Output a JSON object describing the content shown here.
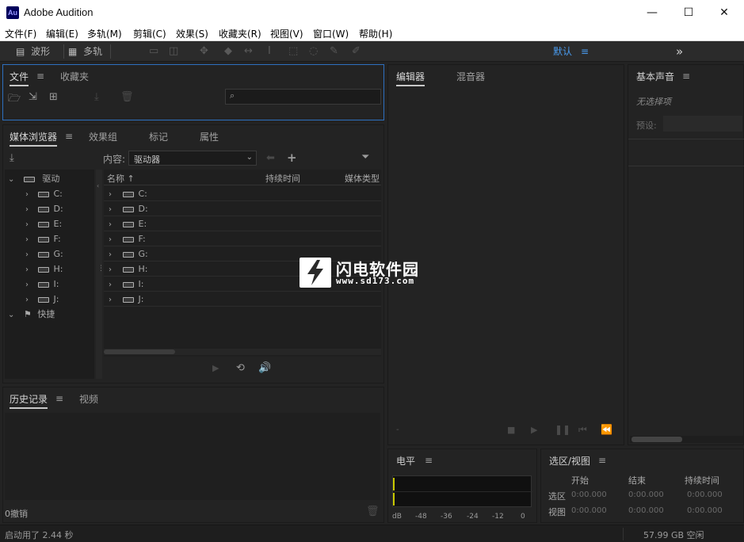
{
  "window": {
    "app_icon": "Au",
    "title": "Adobe Audition",
    "minimize": "—",
    "maximize": "☐",
    "close": "✕"
  },
  "menubar": [
    "文件(F)",
    "编辑(E)",
    "多轨(M)",
    "剪辑(C)",
    "效果(S)",
    "收藏夹(R)",
    "视图(V)",
    "窗口(W)",
    "帮助(H)"
  ],
  "toolbar": {
    "waveform_label": "波形",
    "multitrack_label": "多轨",
    "workspace_label": "默认",
    "overflow_glyph": "»"
  },
  "files_panel": {
    "tabs": [
      "文件",
      "收藏夹"
    ],
    "search_placeholder": ""
  },
  "media_browser": {
    "tabs": [
      "媒体浏览器",
      "效果组",
      "标记",
      "属性"
    ],
    "content_label": "内容:",
    "content_value": "驱动器",
    "tree_root": "驱动",
    "tree_drives": [
      "C:",
      "D:",
      "E:",
      "F:",
      "G:",
      "H:",
      "I:",
      "J:"
    ],
    "tree_shortcuts": "快捷",
    "columns": [
      "名称",
      "持续时间",
      "媒体类型"
    ],
    "list_drives": [
      "C:",
      "D:",
      "E:",
      "F:",
      "G:",
      "H:",
      "I:",
      "J:"
    ]
  },
  "history_panel": {
    "tabs": [
      "历史记录",
      "视频"
    ],
    "undo_count": "0撤销"
  },
  "editor_panel": {
    "tabs": [
      "编辑器",
      "混音器"
    ]
  },
  "essential_sound": {
    "title": "基本声音",
    "no_selection": "无选择项",
    "preset_label": "预设:"
  },
  "level_meter": {
    "title": "电平",
    "scale": [
      "dB",
      "-48",
      "-36",
      "-24",
      "-12",
      "0"
    ]
  },
  "selection_view": {
    "title": "选区/视图",
    "columns": [
      "开始",
      "结束",
      "持续时间"
    ],
    "rows": [
      {
        "label": "选区",
        "start": "0:00.000",
        "end": "0:00.000",
        "duration": "0:00.000"
      },
      {
        "label": "视图",
        "start": "0:00.000",
        "end": "0:00.000",
        "duration": "0:00.000"
      }
    ]
  },
  "status": {
    "startup": "启动用了 2.44 秒",
    "free_space": "57.99 GB 空闲"
  },
  "watermark": {
    "name": "闪电软件园",
    "url": "www.sd173.com"
  }
}
